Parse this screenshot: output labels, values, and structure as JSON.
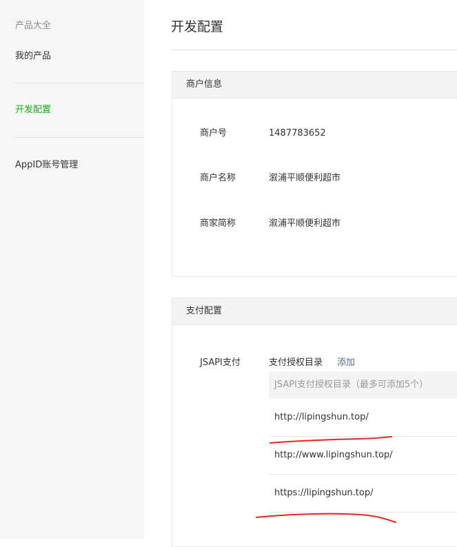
{
  "sidebar": {
    "group_label": "产品大全",
    "items": [
      {
        "label": "我的产品"
      },
      {
        "label": "开发配置"
      },
      {
        "label": "AppID账号管理"
      }
    ]
  },
  "page": {
    "title": "开发配置"
  },
  "merchant_panel": {
    "title": "商户信息",
    "rows": [
      {
        "label": "商户号",
        "value": "1487783652"
      },
      {
        "label": "商户名称",
        "value": "溆浦平顺便利超市"
      },
      {
        "label": "商家简称",
        "value": "溆浦平顺便利超市"
      }
    ]
  },
  "pay_panel": {
    "title": "支付配置",
    "jsapi_label": "JSAPI支付",
    "auth_dir_label": "支付授权目录",
    "add_label": "添加",
    "table_header": "JSAPI支付授权目录（最多可添加5个）",
    "dirs": [
      "http://lipingshun.top/",
      "http://www.lipingshun.top/",
      "https://lipingshun.top/"
    ]
  },
  "colors": {
    "accent_green": "#1aad19",
    "link_blue": "#576b95",
    "annotation_red": "#e8251b"
  }
}
